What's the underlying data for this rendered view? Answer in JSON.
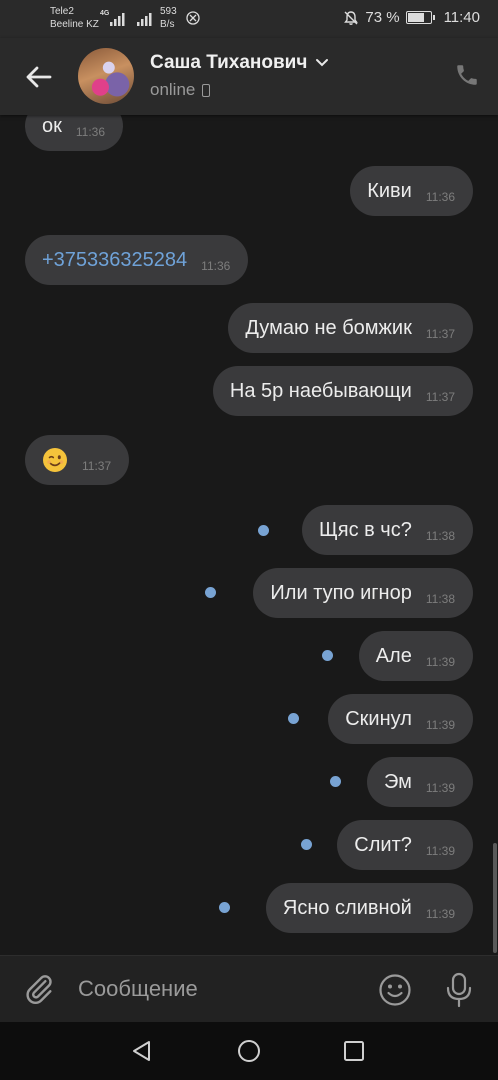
{
  "status_bar": {
    "carrier_1": "Tele2",
    "carrier_2": "Beeline KZ",
    "network": "4G",
    "speed_value": "593",
    "speed_unit": "B/s",
    "battery": "73 %",
    "battery_level": 0.73,
    "time": "11:40"
  },
  "header": {
    "contact_name": "Саша Тиханович",
    "status": "online"
  },
  "messages": [
    {
      "text": "ок",
      "time": "11:36",
      "out": false
    },
    {
      "text": "Киви",
      "time": "11:36",
      "out": true
    },
    {
      "text": "+375336325284",
      "time": "11:36",
      "out": false
    },
    {
      "text": "Думаю не бомжик",
      "time": "11:37",
      "out": true
    },
    {
      "text": "На 5р наебывающи",
      "time": "11:37",
      "out": true
    },
    {
      "emoji": "winking-face",
      "time": "11:37",
      "out": false
    },
    {
      "text": "Щяс в чс?",
      "time": "11:38",
      "out": true
    },
    {
      "text": "Или тупо игнор",
      "time": "11:38",
      "out": true
    },
    {
      "text": "Але",
      "time": "11:39",
      "out": true
    },
    {
      "text": "Скинул",
      "time": "11:39",
      "out": true
    },
    {
      "text": "Эм",
      "time": "11:39",
      "out": true
    },
    {
      "text": "Слит?",
      "time": "11:39",
      "out": true
    },
    {
      "text": "Ясно сливной",
      "time": "11:39",
      "out": true
    }
  ],
  "composer": {
    "placeholder": "Сообщение"
  },
  "colors": {
    "bubble": "#3a3a3c",
    "unread_dot": "#78a3d3",
    "link": "#6fa2d8",
    "background": "#191919"
  }
}
